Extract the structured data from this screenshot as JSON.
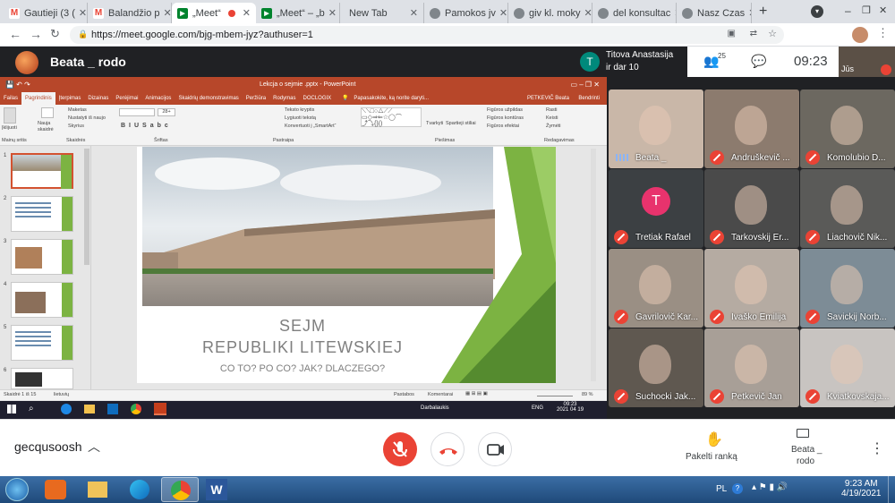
{
  "browser": {
    "tabs": [
      {
        "label": "Gautieji (3 (",
        "favicon": "M",
        "color": "#ea4335"
      },
      {
        "label": "Balandžio p",
        "favicon": "M",
        "color": "#ea4335"
      },
      {
        "label": "„Meet“",
        "favicon": "▶",
        "color": "#00832d",
        "active": true
      },
      {
        "label": "„Meet“ – „b",
        "favicon": "▶",
        "color": "#00832d"
      },
      {
        "label": "New Tab",
        "favicon": "",
        "color": "#dee1e6"
      },
      {
        "label": "Pamokos jv",
        "favicon": "●",
        "color": "#80868b"
      },
      {
        "label": "giv kl. moky",
        "favicon": "●",
        "color": "#80868b"
      },
      {
        "label": "del konsultac",
        "favicon": "●",
        "color": "#80868b"
      },
      {
        "label": "Nasz Czas",
        "favicon": "●",
        "color": "#80868b"
      }
    ],
    "url": "https://meet.google.com/bjg-mbem-jyz?authuser=1"
  },
  "meet": {
    "presenter_name": "Beata _ rodo",
    "notif_name": "Titova Anastasija",
    "notif_sub": "ir dar 10",
    "notif_initial": "T",
    "people_count": "25",
    "time": "09:23",
    "self_label": "Jūs",
    "meeting_code": "gecqusoosh",
    "raise_hand_label": "Pakelti ranką",
    "presenting_label_1": "Beata _",
    "presenting_label_2": "rodo"
  },
  "participants": [
    {
      "name": "Beata _",
      "bg": "#c9b7a8",
      "muted": false
    },
    {
      "name": "Andruškevič ...",
      "bg": "#8c7b6e",
      "muted": true
    },
    {
      "name": "Komolubio D...",
      "bg": "#6c6860",
      "muted": true
    },
    {
      "name": "Tretiak Rafael",
      "bg": "#3c4043",
      "muted": true,
      "initial": "T"
    },
    {
      "name": "Tarkovskij Er...",
      "bg": "#4a4a4a",
      "muted": true
    },
    {
      "name": "Liachovič Nik...",
      "bg": "#5a5a58",
      "muted": true
    },
    {
      "name": "Gavrilovič Kar...",
      "bg": "#9a8f84",
      "muted": true
    },
    {
      "name": "Ivaško Emilija",
      "bg": "#b5aba2",
      "muted": true
    },
    {
      "name": "Savickij Norb...",
      "bg": "#7d8c96",
      "muted": true
    },
    {
      "name": "Suchocki Jak...",
      "bg": "#5f5850",
      "muted": true
    },
    {
      "name": "Petkevič Jan",
      "bg": "#a89f97",
      "muted": true
    },
    {
      "name": "Kviatkovskaja...",
      "bg": "#c8c4c1",
      "muted": true
    }
  ],
  "ppt": {
    "window_title": "Lekcja o sejmie .pptx - PowerPoint",
    "ribbon_tabs": [
      "Failas",
      "Pagrindinis",
      "Įterpimas",
      "Dizainas",
      "Perėjimai",
      "Animacijos",
      "Skaidrių demonstravimas",
      "Peržiūra",
      "Rodymas",
      "DOCLOGIX"
    ],
    "tell_me": "Papasakokite, ką norite daryti...",
    "user": "PETKEVIČ Beata",
    "share": "Bendrinti",
    "groups": [
      "Mainų sritis",
      "Skaidrės",
      "Šriftas",
      "Pastraipa",
      "Piešimas",
      "Redagavimas"
    ],
    "ribbon_items": {
      "paste": "Įklijuoti",
      "new_slide": "Nauja skaidrė",
      "layout": "Maketas",
      "reset": "Nustatyti iš naujo",
      "section": "Skyrius",
      "text_direction": "Teksto kryptis",
      "align_text": "Lygiuoti tekstą",
      "smartart": "Konvertuoti į „SmartArt“",
      "arrange": "Tvarkyti",
      "quick_styles": "Spartieji stiliai",
      "shape_fill": "Figūros užpildas",
      "shape_outline": "Figūros kontūras",
      "shape_effects": "Figūros efektai",
      "find": "Rasti",
      "replace": "Keisti",
      "select": "Žymėti",
      "font_size": "28+"
    },
    "slide_numbers": [
      "1",
      "2",
      "3",
      "4",
      "5",
      "6"
    ],
    "slide_title_1": "SEJM",
    "slide_title_2": "REPUBLIKI LITEWSKIEJ",
    "slide_subtitle": "CO TO? PO CO? JAK? DLACZEGO?",
    "status_left": "Skaidrė 1 iš 15",
    "status_lang": "lietuvių",
    "notes": "Pastabos",
    "comments": "Komentarai",
    "zoom": "89 %",
    "taskbar_desktop": "Darbalaukis",
    "taskbar_lang": "ENG",
    "taskbar_time": "09:23",
    "taskbar_date": "2021 04 19"
  },
  "windows": {
    "lang": "PL",
    "time": "9:23 AM",
    "date": "4/19/2021"
  }
}
